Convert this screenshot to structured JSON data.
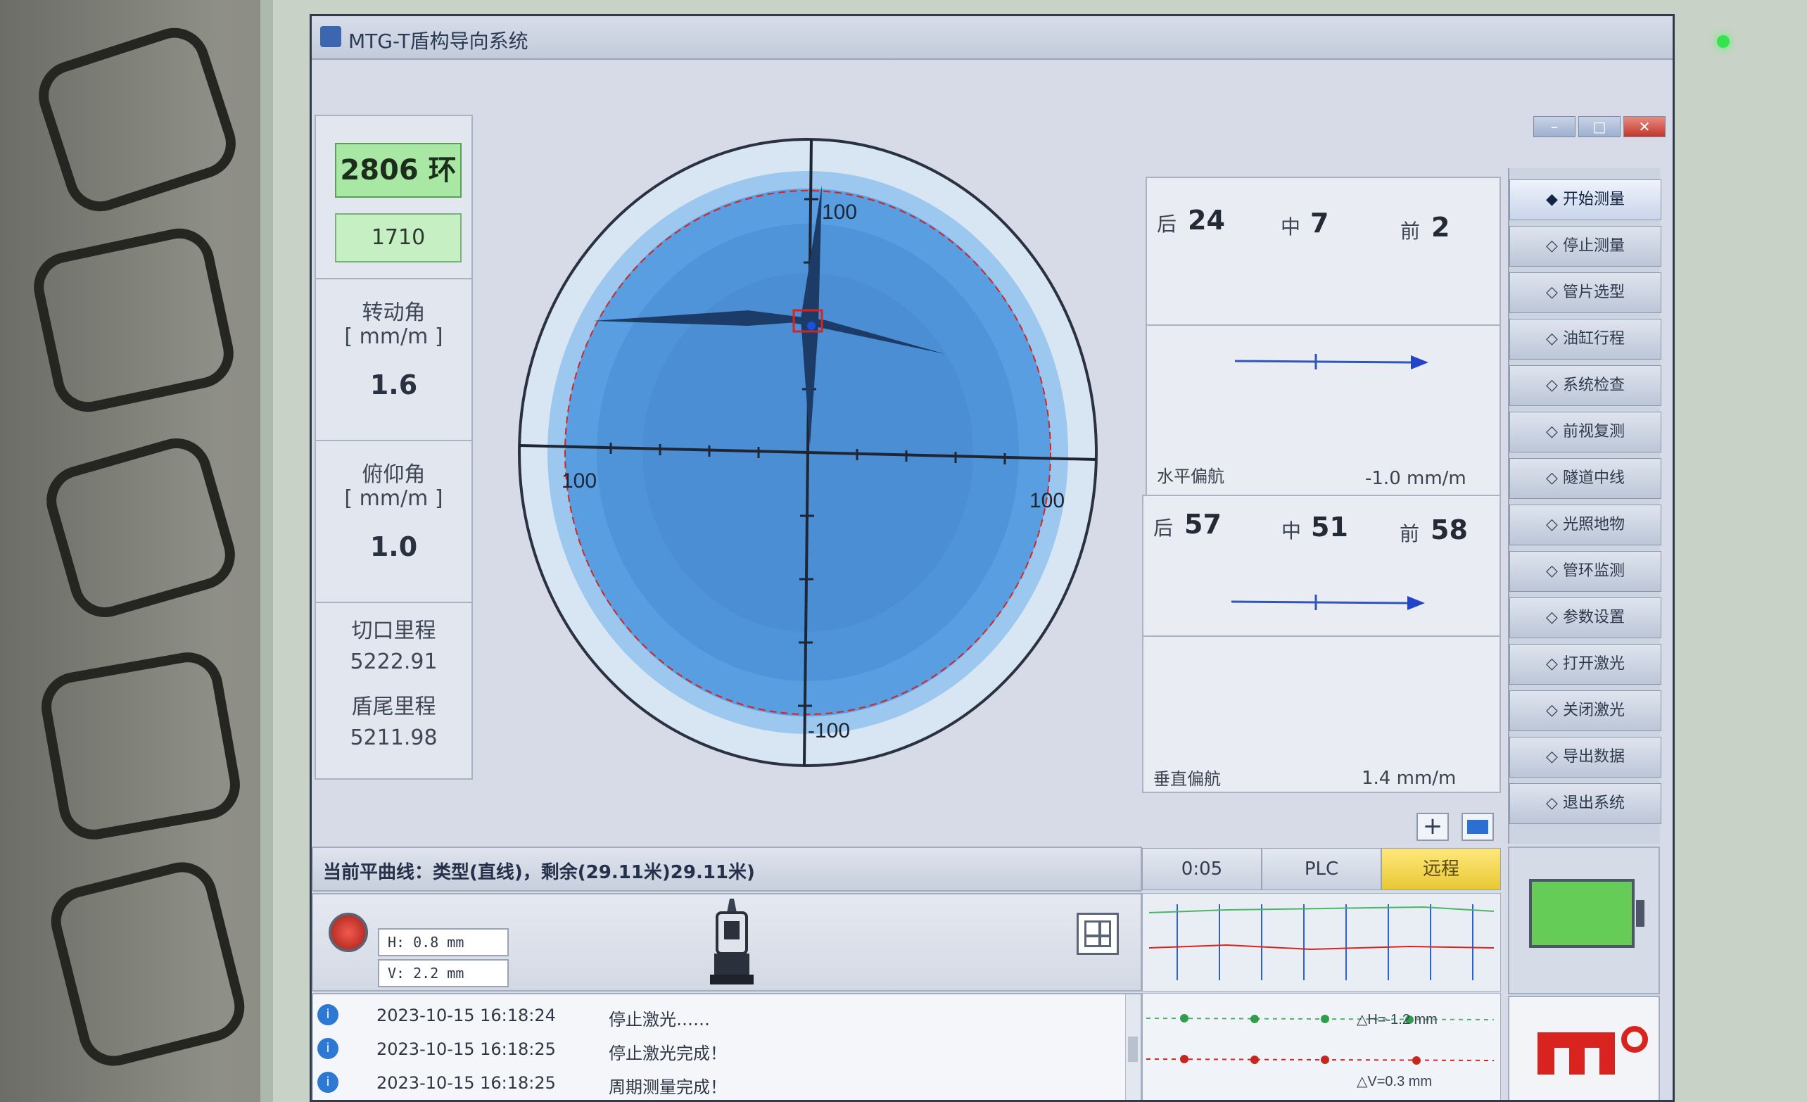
{
  "window": {
    "title": "MTG-T盾构导向系统"
  },
  "left_panel": {
    "ring_value": "2806 环",
    "ring_sub_value": "1710",
    "rotation": {
      "label": "转动角",
      "unit": "[ mm/m ]",
      "value": "1.6"
    },
    "pitch": {
      "label": "俯仰角",
      "unit": "[ mm/m ]",
      "value": "1.0"
    },
    "cutter_mileage": {
      "label": "切口里程",
      "value": "5222.91"
    },
    "tail_mileage": {
      "label": "盾尾里程",
      "value": "5211.98"
    }
  },
  "target": {
    "top_label": "100",
    "left_label": "100",
    "right_label": "100",
    "bottom_label": "-100"
  },
  "horizontal_panel": {
    "rear_label": "后",
    "rear_value": "24",
    "mid_label": "中",
    "mid_value": "7",
    "front_label": "前",
    "front_value": "2",
    "title": "水平偏航",
    "rate": "-1.0 mm/m"
  },
  "vertical_panel": {
    "rear_label": "后",
    "rear_value": "57",
    "mid_label": "中",
    "mid_value": "51",
    "front_label": "前",
    "front_value": "58",
    "title": "垂直偏航",
    "rate": "1.4 mm/m"
  },
  "side_menu": [
    {
      "label": "◆ 开始测量",
      "active": true
    },
    {
      "label": "◇ 停止测量"
    },
    {
      "label": "◇ 管片选型"
    },
    {
      "label": "◇ 油缸行程"
    },
    {
      "label": "◇ 系统检查"
    },
    {
      "label": "◇ 前视复测"
    },
    {
      "label": "◇ 隧道中线"
    },
    {
      "label": "◇ 光照地物"
    },
    {
      "label": "◇ 管环监测"
    },
    {
      "label": "◇ 参数设置"
    },
    {
      "label": "◇ 打开激光"
    },
    {
      "label": "◇ 关闭激光"
    },
    {
      "label": "◇ 导出数据"
    },
    {
      "label": "◇ 退出系统"
    }
  ],
  "tools": {
    "plus": "+"
  },
  "curve_status": "当前平曲线：类型(直线)，剩余(29.11米)29.11米)",
  "chips": {
    "time": "0:05",
    "plc": "PLC",
    "remote": "远程"
  },
  "laser": {
    "h_label": "H: 0.8 mm",
    "v_label": "V: 2.2 mm"
  },
  "log": [
    {
      "ts": "2023-10-15 16:18:24",
      "msg": "停止激光……"
    },
    {
      "ts": "2023-10-15 16:18:25",
      "msg": "停止激光完成！"
    },
    {
      "ts": "2023-10-15 16:18:25",
      "msg": "周期测量完成！"
    }
  ],
  "mini_chart": {
    "h_label": "△H=-1.2 mm",
    "v_label": "△V=0.3 mm"
  },
  "colors": {
    "accent_red": "#d8231e",
    "battery_green": "#66cc58",
    "remote_yellow": "#f2d544"
  }
}
